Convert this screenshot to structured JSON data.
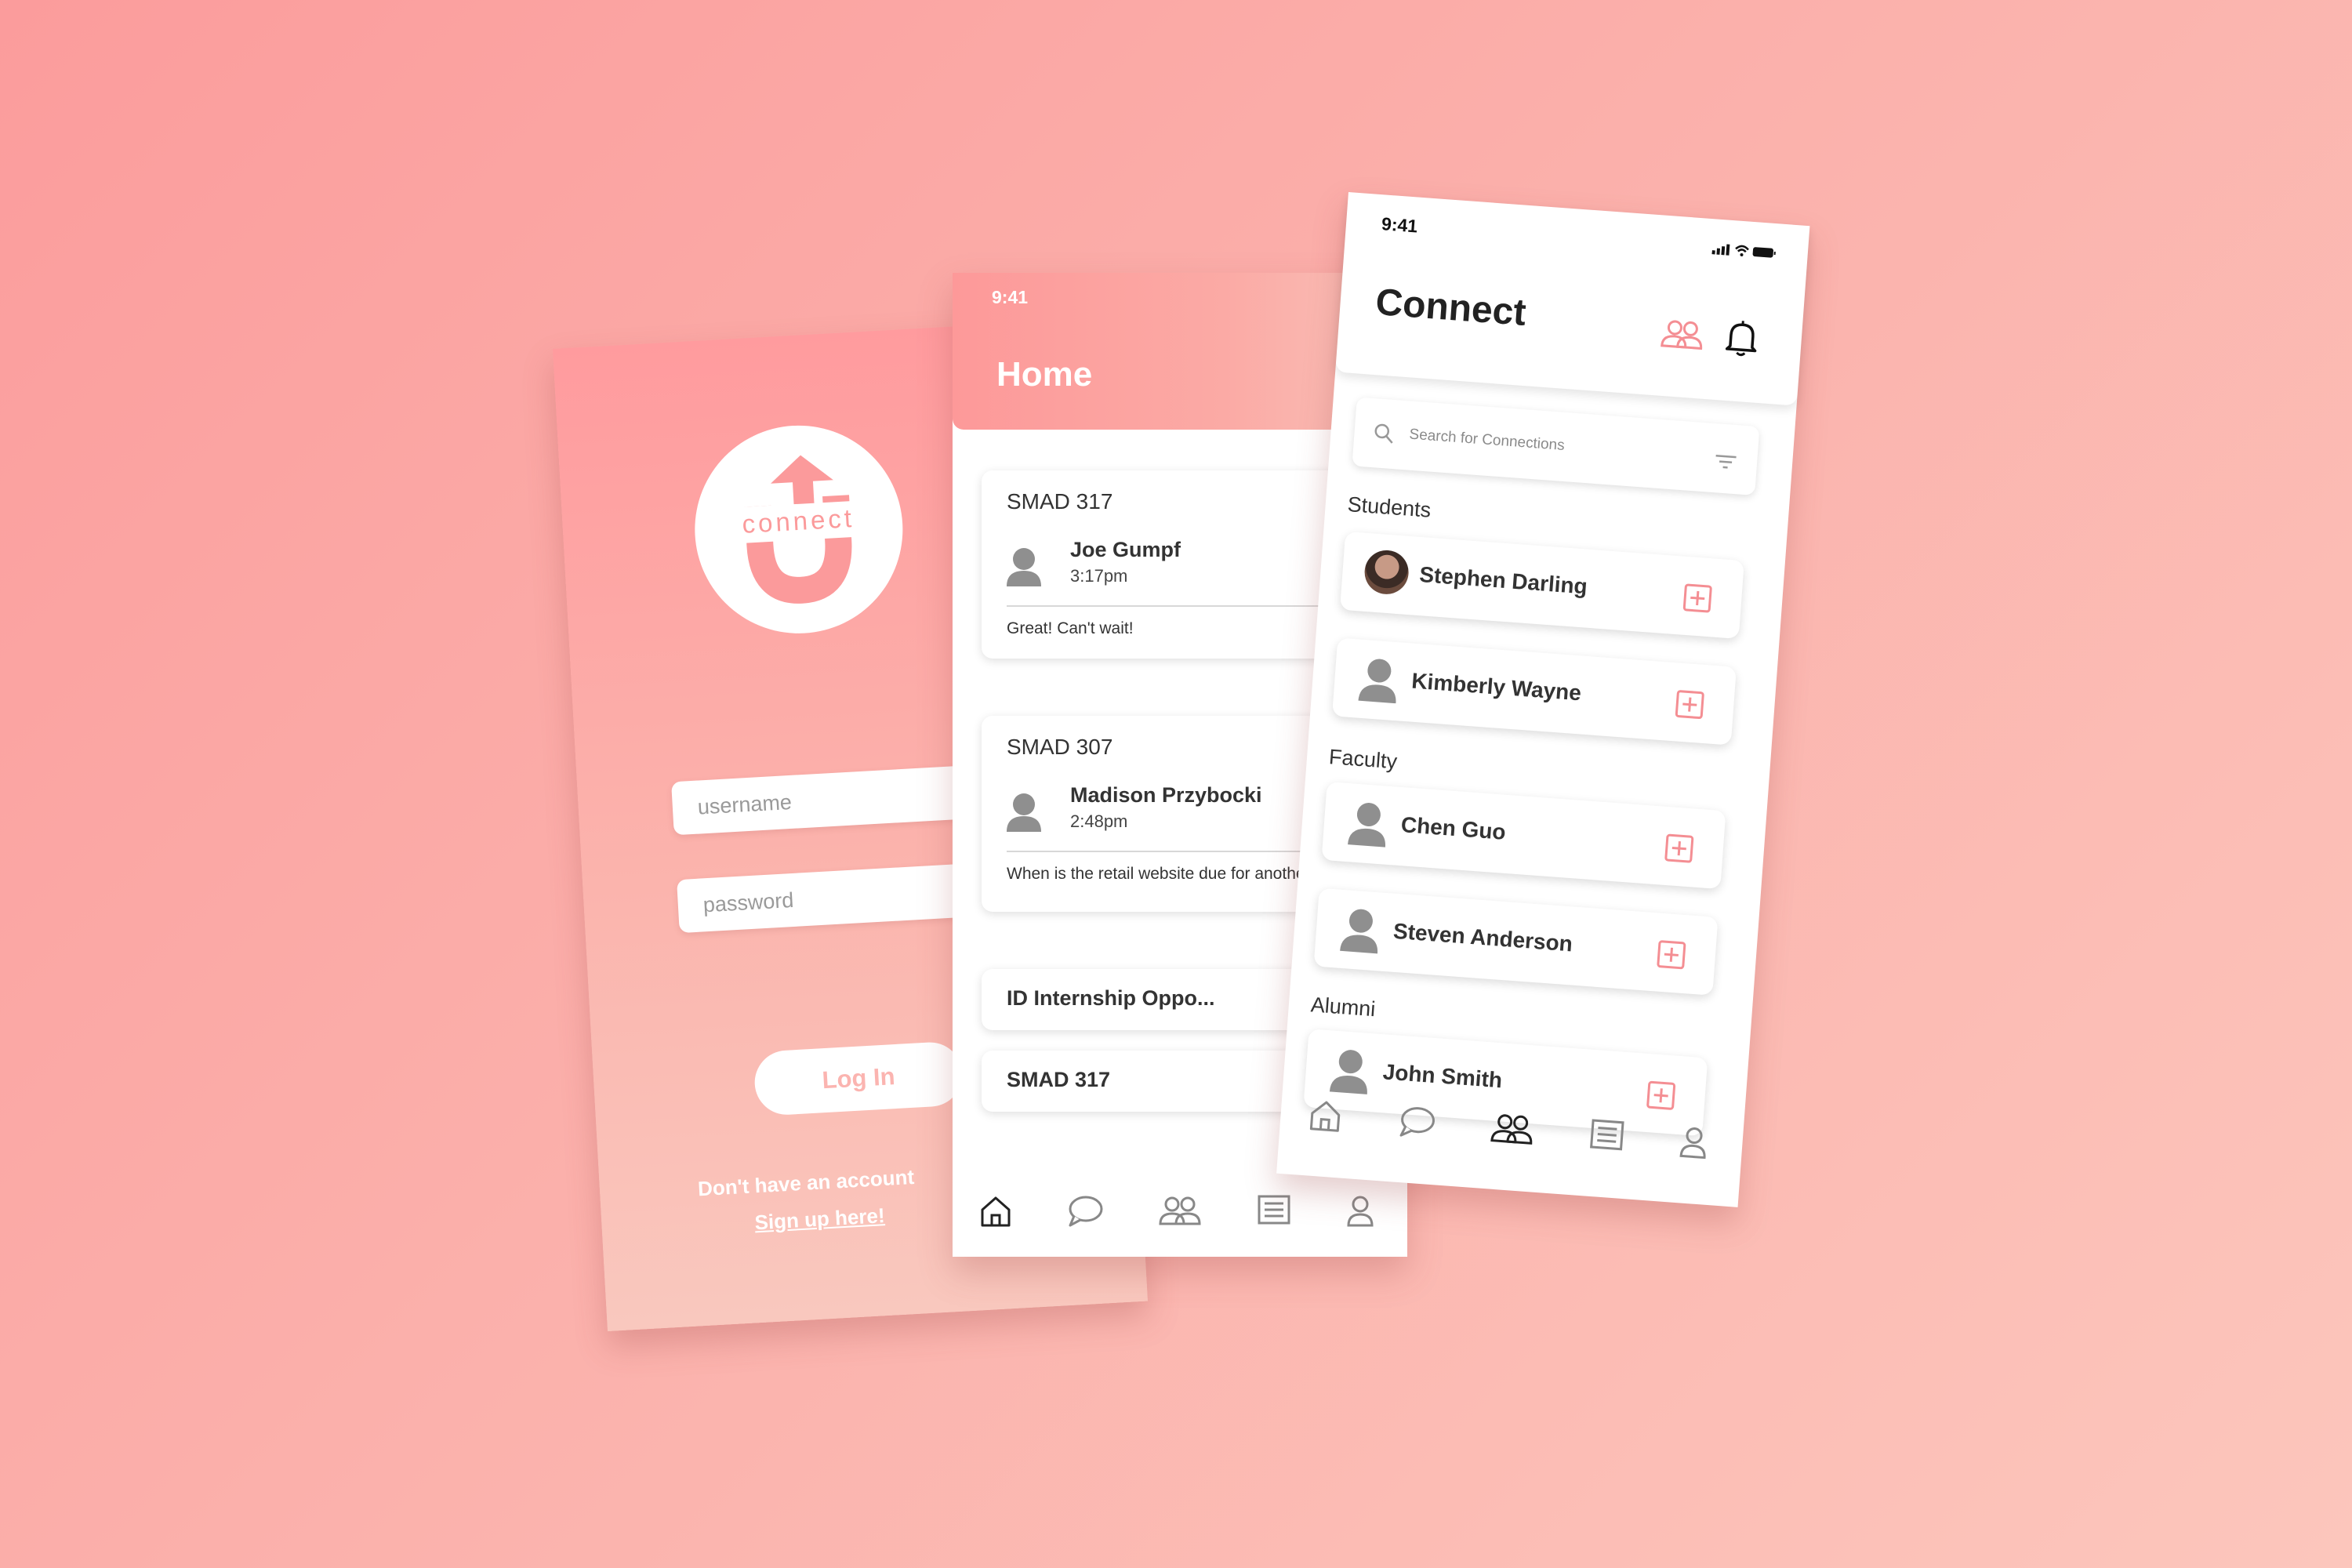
{
  "login": {
    "logo_text": "connect",
    "username_placeholder": "username",
    "password_placeholder": "password",
    "login_button": "Log In",
    "no_account_text": "Don't have an account",
    "signup_link": "Sign up here!",
    "accent": "#fb9a9b"
  },
  "home": {
    "status_time": "9:41",
    "title": "Home",
    "cards": [
      {
        "course": "SMAD 317",
        "sender": "Joe Gumpf",
        "time": "3:17pm",
        "message": "Great! Can't wait!"
      },
      {
        "course": "SMAD 307",
        "sender": "Madison Przybocki",
        "time": "2:48pm",
        "message": "When is the retail website due for another"
      }
    ],
    "small_cards": [
      "ID Internship Oppo...",
      "SMAD 317"
    ],
    "nav": [
      "home-icon",
      "chat-icon",
      "people-icon",
      "list-icon",
      "profile-icon"
    ],
    "active_nav": "home-icon"
  },
  "connect": {
    "status_time": "9:41",
    "title": "Connect",
    "search_placeholder": "Search for Connections",
    "sections": {
      "students": "Students",
      "faculty": "Faculty",
      "alumni": "Alumni"
    },
    "people": {
      "students": [
        "Stephen Darling",
        "Kimberly Wayne"
      ],
      "faculty": [
        "Chen Guo",
        "Steven Anderson"
      ],
      "alumni": [
        "John Smith"
      ]
    },
    "nav": [
      "home-icon",
      "chat-icon",
      "people-icon",
      "list-icon",
      "profile-icon"
    ],
    "active_nav": "people-icon",
    "accent": "#f48e93"
  }
}
